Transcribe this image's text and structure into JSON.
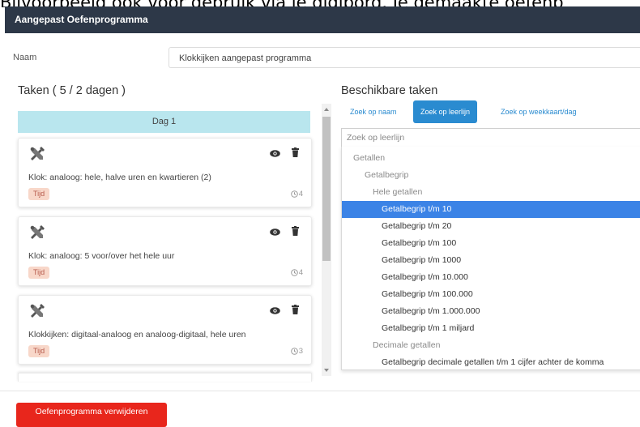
{
  "caption": "Bijvoorbeeld ook voor gebruik via je digibord. Je gemaakte oefenp",
  "window": {
    "title": "Aangepast Oefenprogramma"
  },
  "form": {
    "name_label": "Naam",
    "name_value": "Klokkijken aangepast programma"
  },
  "tasks_panel": {
    "title": "Taken ( 5 / 2 dagen )",
    "day_header": "Dag 1",
    "tasks": [
      {
        "title": "Klok: analoog: hele, halve uren en kwartieren (2)",
        "tag": "Tijd",
        "count": "4"
      },
      {
        "title": "Klok: analoog: 5 voor/over het hele uur",
        "tag": "Tijd",
        "count": "4"
      },
      {
        "title": "Klokkijken: digitaal-analoog en analoog-digitaal, hele uren",
        "tag": "Tijd",
        "count": "3"
      }
    ]
  },
  "available_panel": {
    "title": "Beschikbare taken",
    "tabs": [
      "Zoek op naam",
      "Zoek op leerlijn",
      "Zoek op weekkaart/dag"
    ],
    "active_tab": "Zoek op leerlijn",
    "filter_placeholder": "Zoek op leerlijn",
    "tree": [
      {
        "label": "Getallen",
        "level": 0,
        "type": "group"
      },
      {
        "label": "Getalbegrip",
        "level": 1,
        "type": "group"
      },
      {
        "label": "Hele getallen",
        "level": 2,
        "type": "group"
      },
      {
        "label": "Getalbegrip t/m 10",
        "level": 3,
        "type": "item",
        "selected": true
      },
      {
        "label": "Getalbegrip t/m 20",
        "level": 3,
        "type": "item"
      },
      {
        "label": "Getalbegrip t/m 100",
        "level": 3,
        "type": "item"
      },
      {
        "label": "Getalbegrip t/m 1000",
        "level": 3,
        "type": "item"
      },
      {
        "label": "Getalbegrip t/m 10.000",
        "level": 3,
        "type": "item"
      },
      {
        "label": "Getalbegrip t/m 100.000",
        "level": 3,
        "type": "item"
      },
      {
        "label": "Getalbegrip t/m 1.000.000",
        "level": 3,
        "type": "item"
      },
      {
        "label": "Getalbegrip t/m 1 miljard",
        "level": 3,
        "type": "item"
      },
      {
        "label": "Decimale getallen",
        "level": 2,
        "type": "group"
      },
      {
        "label": "Getalbegrip decimale getallen t/m 1 cijfer achter de komma",
        "level": 3,
        "type": "item"
      }
    ]
  },
  "footer": {
    "delete_label": "Oefenprogramma verwijderen"
  },
  "icons": {
    "tool": "tools-icon",
    "view": "eye-icon",
    "delete": "trash-icon",
    "clock": "clock-icon"
  },
  "colors": {
    "titlebar": "#2d3848",
    "accent": "#2a8bd0",
    "selected": "#3b83e6",
    "danger": "#e8261c",
    "day_header": "#b9e6ee",
    "tag_bg": "#f8d7c9"
  }
}
